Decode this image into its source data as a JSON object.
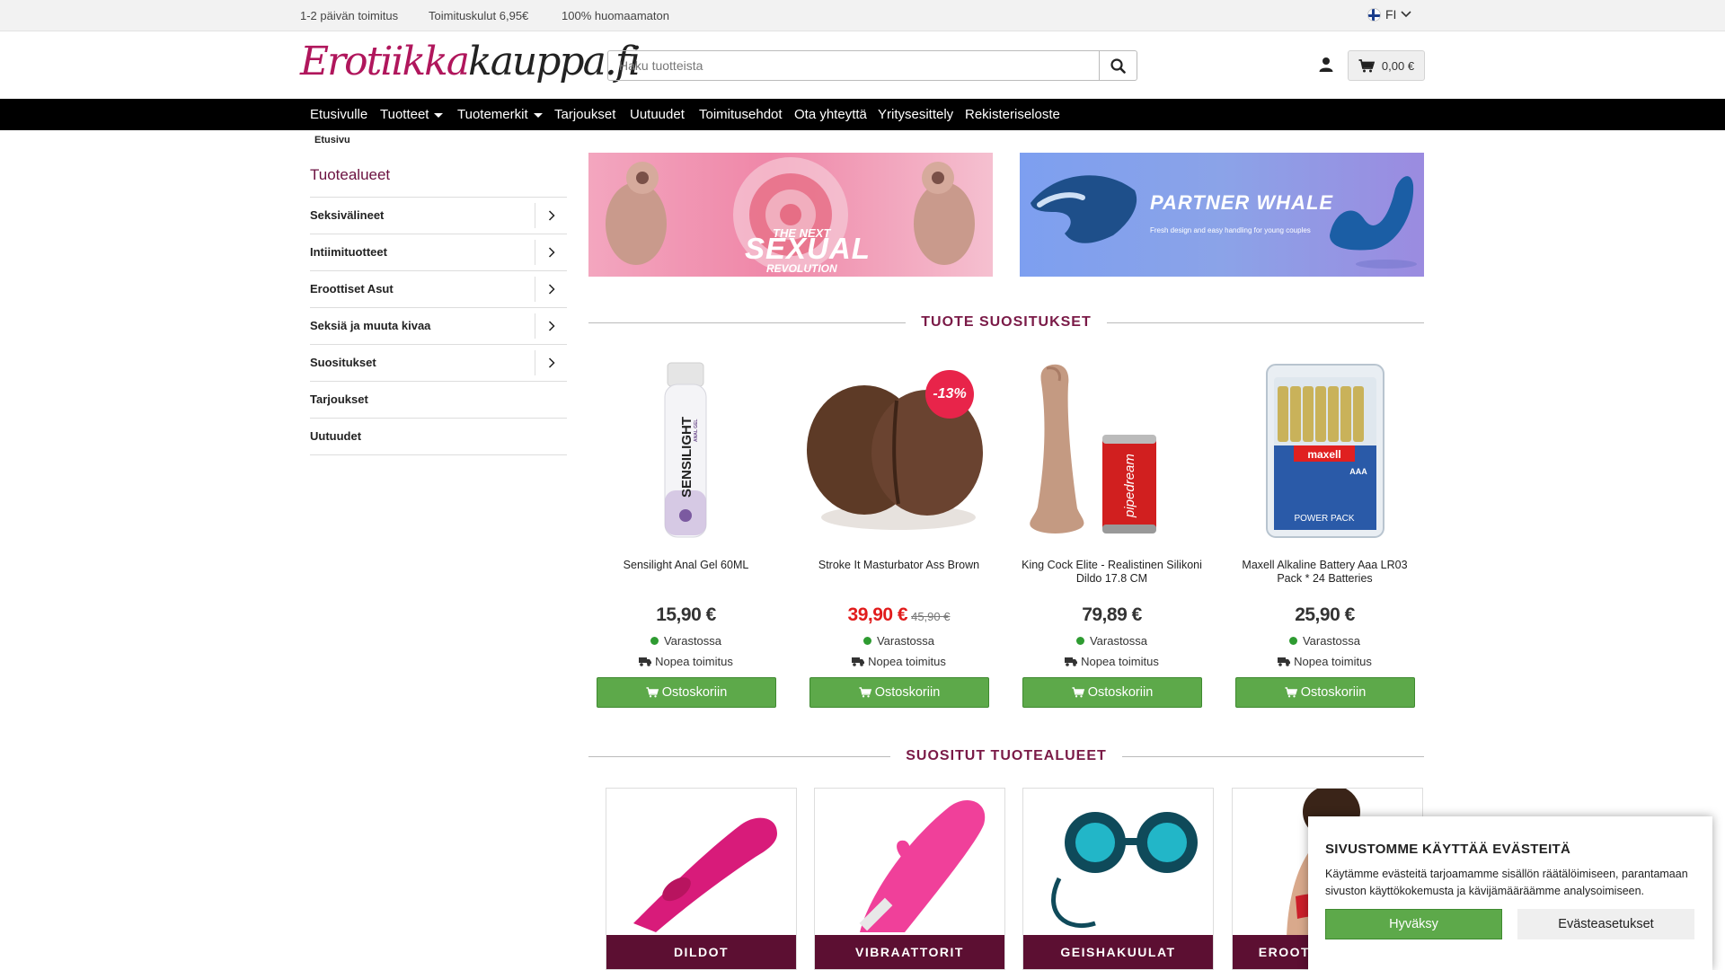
{
  "topbar": {
    "info": [
      "1-2 päivän toimitus",
      "Toimituskulut 6,95€",
      "100% huomaamaton"
    ],
    "language": "FI"
  },
  "header": {
    "logo_part1": "Erotiikka",
    "logo_part2": "kauppa.fi",
    "search_placeholder": "Haku tuotteista",
    "cart_total": "0,00 €"
  },
  "nav": {
    "items": [
      "Etusivulle",
      "Tuotteet",
      "Tuotemerkit",
      "Tarjoukset",
      "Uutuudet",
      "Toimitusehdot",
      "Ota yhteyttä",
      "Yritysesittely",
      "Rekisteriseloste"
    ]
  },
  "breadcrumb": "Etusivu",
  "sidebar": {
    "title": "Tuotealueet",
    "items": [
      "Seksivälineet",
      "Intiimituotteet",
      "Eroottiset Asut",
      "Seksiä ja muuta kivaa",
      "Suositukset",
      "Tarjoukset",
      "Uutuudet"
    ]
  },
  "banners": {
    "b1": {
      "line1": "THE NEXT",
      "line2": "SEXUAL",
      "line3": "REVOLUTION"
    },
    "b2": {
      "title": "PARTNER WHALE",
      "subtitle": "Fresh design and easy handling for young couples"
    }
  },
  "sections": {
    "recommended": "TUOTE SUOSITUKSET",
    "categories": "SUOSITUT TUOTEALUEET"
  },
  "products": [
    {
      "name": "Sensilight Anal Gel 60ML",
      "price": "15,90 €",
      "old_price": "",
      "stock": "Varastossa",
      "shipping": "Nopea toimitus",
      "button": "Ostoskoriin",
      "label": "SENSILIGHT",
      "sublabel": "ANAL GEL"
    },
    {
      "name": "Stroke It Masturbator Ass Brown",
      "price": "39,90 €",
      "old_price": "45,90 €",
      "badge": "-13%",
      "stock": "Varastossa",
      "shipping": "Nopea toimitus",
      "button": "Ostoskoriin"
    },
    {
      "name": "King Cock Elite - Realistinen Silikoni Dildo 17.8 CM",
      "price": "79,89 €",
      "old_price": "",
      "stock": "Varastossa",
      "shipping": "Nopea toimitus",
      "button": "Ostoskoriin",
      "label": "pipedream"
    },
    {
      "name": "Maxell Alkaline Battery Aaa LR03 Pack * 24 Batteries",
      "price": "25,90 €",
      "old_price": "",
      "stock": "Varastossa",
      "shipping": "Nopea toimitus",
      "button": "Ostoskoriin",
      "label": "maxell",
      "sublabel": "POWER PACK",
      "size": "AAA"
    }
  ],
  "categories": [
    "DILDOT",
    "VIBRAATTORIT",
    "GEISHAKUULAT",
    "EROOTTISET ASUT"
  ],
  "cookie": {
    "title": "SIVUSTOMME KÄYTTÄÄ EVÄSTEITÄ",
    "text": "Käytämme evästeitä tarjoamamme sisällön räätälöimiseen, parantamaan sivuston käyttökokemusta ja kävijämääräämme analysoimiseen.",
    "accept": "Hyväksy",
    "settings": "Evästeasetukset"
  },
  "colors": {
    "brand": "#b0165c",
    "heading": "#7a1a47",
    "category_label_bg": "#5c0f32",
    "button_green": "#5da94a",
    "sale_red": "#e11b1b"
  }
}
